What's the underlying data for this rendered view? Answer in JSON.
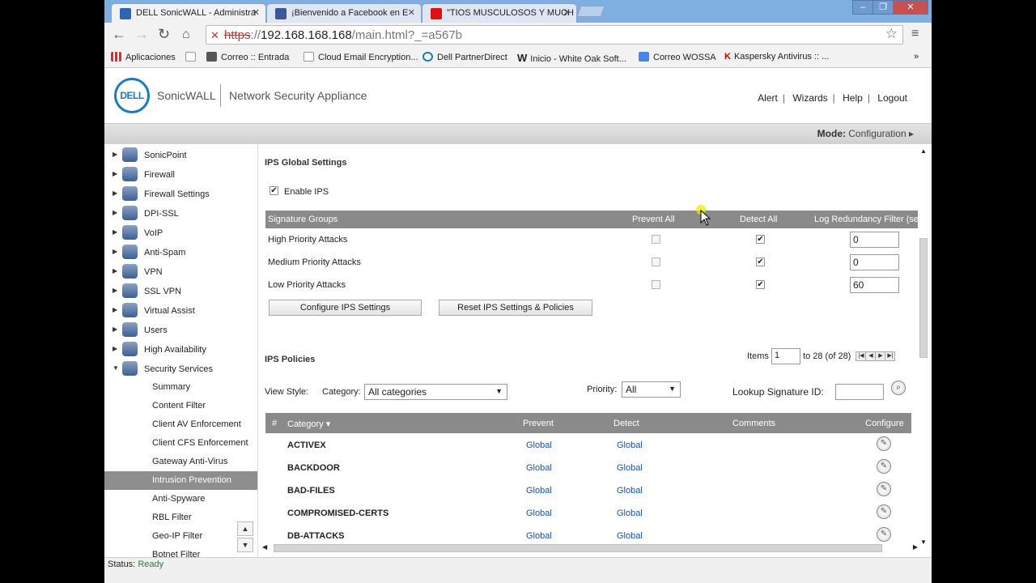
{
  "browser": {
    "tabs": [
      {
        "title": "DELL SonicWALL - Administra",
        "close": "✕"
      },
      {
        "title": "¡Bienvenido a Facebook en E",
        "close": "✕"
      },
      {
        "title": "\"TIOS MUSCULOSOS Y MUCH",
        "close": "✕"
      }
    ],
    "window_controls": [
      "–",
      "❐",
      "✕"
    ],
    "address": {
      "scheme": "https",
      "sep": "://",
      "host": "192.168.168.168",
      "path": "/main.html?_=a567b"
    },
    "bookmarks": [
      "Aplicaciones",
      "Correo :: Entrada",
      "Cloud Email Encryption...",
      "Dell PartnerDirect",
      "Inicio - White Oak Soft...",
      "Correo WOSSA",
      "Kaspersky Antivirus :: ..."
    ],
    "more": "»"
  },
  "header": {
    "logo_text": "DELL",
    "brand": "SonicWALL",
    "product": "Network Security Appliance",
    "links": [
      "Alert",
      "Wizards",
      "Help",
      "Logout"
    ],
    "mode_label": "Mode:",
    "mode_value": "Configuration ▸"
  },
  "nav": {
    "items": [
      "SonicPoint",
      "Firewall",
      "Firewall Settings",
      "DPI-SSL",
      "VoIP",
      "Anti-Spam",
      "VPN",
      "SSL VPN",
      "Virtual Assist",
      "Users",
      "High Availability",
      "Security Services"
    ],
    "subitems": [
      "Summary",
      "Content Filter",
      "Client AV Enforcement",
      "Client CFS Enforcement",
      "Gateway Anti-Virus",
      "Intrusion Prevention",
      "Anti-Spyware",
      "RBL Filter",
      "Geo-IP Filter",
      "Botnet Filter"
    ],
    "selected_sub": "Intrusion Prevention"
  },
  "global": {
    "title": "IPS Global Settings",
    "enable_label": "Enable IPS",
    "enable_checked": true,
    "headers": {
      "groups": "Signature Groups",
      "prevent": "Prevent All",
      "detect": "Detect All",
      "log": "Log Redundancy Filter (sec"
    },
    "rows": [
      {
        "label": "High Priority Attacks",
        "prevent": false,
        "detect": true,
        "log": "0"
      },
      {
        "label": "Medium Priority Attacks",
        "prevent": false,
        "detect": true,
        "log": "0"
      },
      {
        "label": "Low Priority Attacks",
        "prevent": false,
        "detect": true,
        "log": "60"
      }
    ],
    "btn_configure": "Configure IPS Settings",
    "btn_reset": "Reset IPS Settings & Policies"
  },
  "policies": {
    "title": "IPS Policies",
    "items_label": "Items",
    "items_value": "1",
    "items_range": "to 28 (of 28)",
    "view_style": "View Style:",
    "category_label": "Category:",
    "category_value": "All categories",
    "priority_label": "Priority:",
    "priority_value": "All",
    "lookup_label": "Lookup Signature ID:",
    "headers": {
      "num": "#",
      "category": "Category ▾",
      "prevent": "Prevent",
      "detect": "Detect",
      "comments": "Comments",
      "configure": "Configure"
    },
    "rows": [
      {
        "category": "ACTIVEX",
        "prevent": "Global",
        "detect": "Global"
      },
      {
        "category": "BACKDOOR",
        "prevent": "Global",
        "detect": "Global"
      },
      {
        "category": "BAD-FILES",
        "prevent": "Global",
        "detect": "Global"
      },
      {
        "category": "COMPROMISED-CERTS",
        "prevent": "Global",
        "detect": "Global"
      },
      {
        "category": "DB-ATTACKS",
        "prevent": "Global",
        "detect": "Global"
      }
    ]
  },
  "status": {
    "label": "Status:",
    "value": "Ready"
  }
}
